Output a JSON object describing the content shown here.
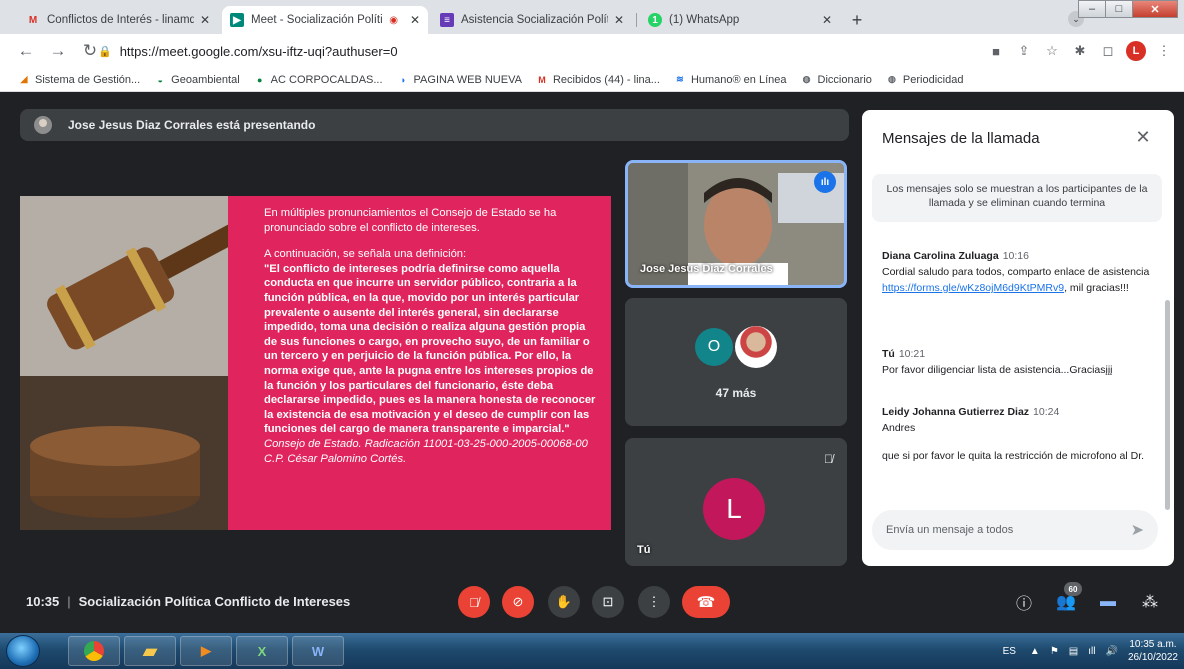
{
  "browser": {
    "tabs": [
      {
        "title": "Conflictos de Interés - linamdaza",
        "active": false
      },
      {
        "title": "Meet - Socialización Política",
        "active": true
      },
      {
        "title": "Asistencia Socialización Política d",
        "active": false
      },
      {
        "title": "(1) WhatsApp",
        "active": false
      }
    ],
    "url": "https://meet.google.com/xsu-iftz-uqi?authuser=0",
    "profile_initial": "L",
    "bookmarks": [
      "Sistema de Gestión...",
      "Geoambiental",
      "AC CORPOCALDAS...",
      "PAGINA WEB NUEVA",
      "Recibidos (44) - lina...",
      "Humano® en Línea",
      "Diccionario",
      "Periodicidad"
    ]
  },
  "meet": {
    "presenting_banner": "Jose Jesus Diaz Corrales está presentando",
    "slide": {
      "intro": "En múltiples pronunciamientos el Consejo de Estado se ha pronunciado sobre el conflicto de intereses.",
      "lead": "A continuación, se señala una definición:",
      "quote": "\"El conflicto de intereses podría definirse como aquella conducta en que incurre un servidor público, contraria a la función pública, en la que, movido por un interés particular prevalente o ausente del interés general, sin declararse impedido, toma una decisión o realiza alguna gestión propia de sus funciones o cargo, en provecho suyo, de un familiar o un tercero y en perjuicio de la función pública. Por ello, la norma exige que, ante la pugna entre los intereses propios de la función y los particulares del funcionario, éste deba declararse impedido, pues es la manera honesta de reconocer la existencia de esa motivación y el deseo de cumplir con las funciones del cargo de manera transparente e imparcial.\"",
      "citation": "Consejo de Estado. Radicación 11001-03-25-000-2005-00068-00 C.P. César Palomino Cortés."
    },
    "tiles": {
      "presenter_name": "Jose Jesus Diaz Corrales",
      "more_avatar_initial": "O",
      "more_label": "47 más",
      "self_initial": "L",
      "self_label": "Tú"
    },
    "chat": {
      "title": "Mensajes de la llamada",
      "notice": "Los mensajes solo se muestran a los participantes de la llamada y se eliminan cuando termina",
      "messages": [
        {
          "author": "Diana Carolina Zuluaga",
          "time": "10:16",
          "text_before": "Cordial saludo para todos, comparto enlace de asistencia ",
          "link": "https://forms.gle/wKz8ojM6d9KtPMRv9",
          "text_after": ", mil gracias!!!"
        },
        {
          "author": "Tú",
          "time": "10:21",
          "text": "Por favor diligenciar lista de asistencia...Graciasįįį"
        },
        {
          "author": "Leidy Johanna Gutierrez Diaz",
          "time": "10:24",
          "text": "Andres",
          "text2": "que si por favor le quita la restricción de microfono al Dr."
        }
      ],
      "input_placeholder": "Envía un mensaje a todos"
    },
    "bottom": {
      "time": "10:35",
      "meeting_title": "Socialización Política Conflicto de Intereses",
      "participants_count": "60"
    }
  },
  "taskbar": {
    "language": "ES",
    "clock_time": "10:35 a.m.",
    "clock_date": "26/10/2022"
  },
  "colors": {
    "slide_pink": "#e0245e",
    "meet_bg": "#202124",
    "tile_bg": "#3c4043",
    "danger": "#ea4335",
    "accent_blue": "#1a73e8"
  }
}
